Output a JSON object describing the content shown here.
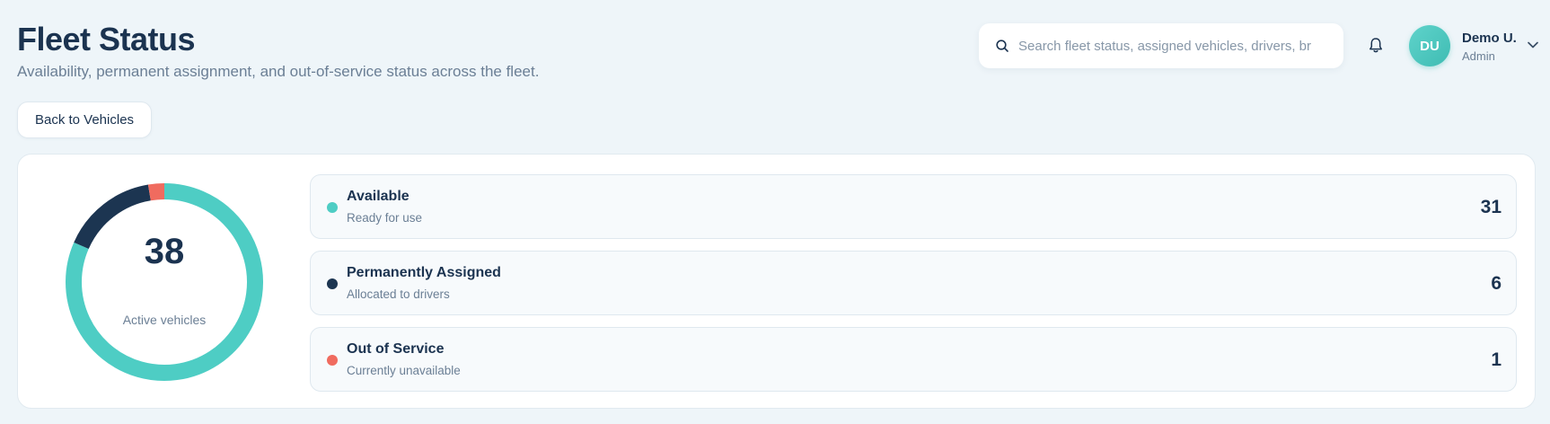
{
  "header": {
    "title": "Fleet Status",
    "subtitle": "Availability, permanent assignment, and out-of-service status across the fleet."
  },
  "search": {
    "placeholder": "Search fleet status, assigned vehicles, drivers, br",
    "value": ""
  },
  "user": {
    "initials": "DU",
    "name": "Demo U.",
    "role": "Admin"
  },
  "back_button_label": "Back to Vehicles",
  "summary": {
    "total": "38",
    "total_caption": "Active vehicles"
  },
  "colors": {
    "available": "#4ecdc4",
    "assigned": "#1c3551",
    "out_of_service": "#f06b5f"
  },
  "icons": {
    "search": "search-icon",
    "bell": "bell-icon",
    "chevron": "chevron-down-icon"
  },
  "statuses": [
    {
      "label": "Available",
      "description": "Ready for use",
      "count": "31",
      "color": "#4ecdc4"
    },
    {
      "label": "Permanently Assigned",
      "description": "Allocated to drivers",
      "count": "6",
      "color": "#1c3551"
    },
    {
      "label": "Out of Service",
      "description": "Currently unavailable",
      "count": "1",
      "color": "#f06b5f"
    }
  ]
}
